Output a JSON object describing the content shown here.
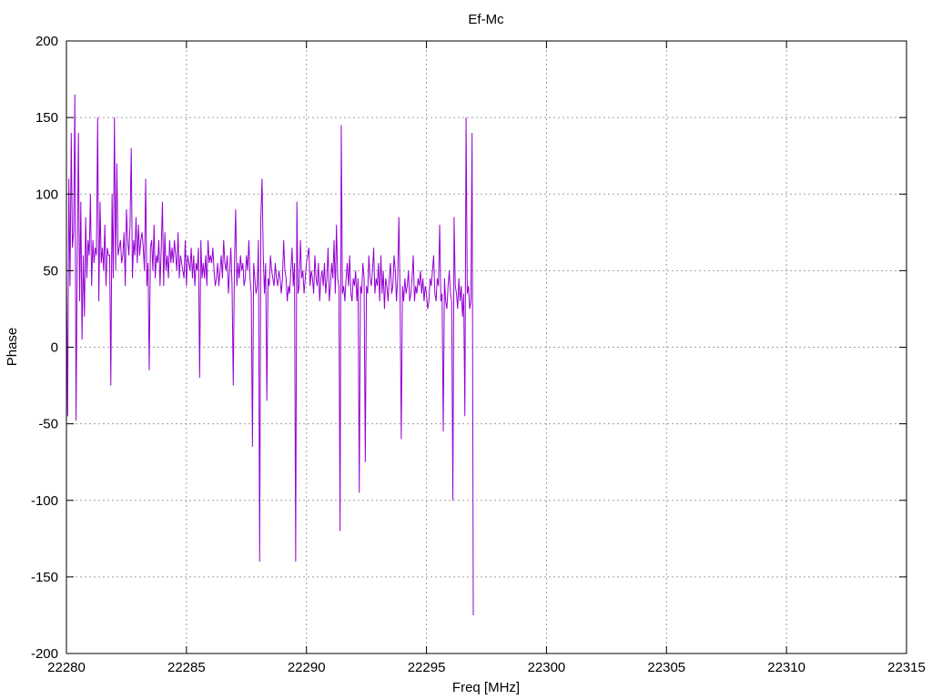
{
  "chart_data": {
    "type": "line",
    "title": "Ef-Mc",
    "xlabel": "Freq [MHz]",
    "ylabel": "Phase",
    "xlim": [
      22280,
      22315
    ],
    "ylim": [
      -200,
      200
    ],
    "xticks": [
      22280,
      22285,
      22290,
      22295,
      22300,
      22305,
      22310,
      22315
    ],
    "yticks": [
      -200,
      -150,
      -100,
      -50,
      0,
      50,
      100,
      150,
      200
    ],
    "grid": true,
    "line_color": "#9400d3",
    "series": [
      {
        "x_start": 22280.0,
        "x_step": 0.05,
        "values": [
          45,
          -45,
          110,
          40,
          140,
          65,
          75,
          165,
          -48,
          55,
          140,
          30,
          95,
          5,
          60,
          20,
          85,
          45,
          70,
          60,
          100,
          40,
          70,
          55,
          65,
          60,
          150,
          30,
          95,
          55,
          65,
          50,
          80,
          40,
          65,
          60,
          60,
          -25,
          100,
          45,
          150,
          50,
          120,
          60,
          65,
          70,
          55,
          60,
          75,
          40,
          90,
          70,
          60,
          80,
          130,
          45,
          70,
          60,
          85,
          55,
          80,
          60,
          70,
          75,
          65,
          50,
          110,
          40,
          55,
          -15,
          65,
          70,
          50,
          80,
          45,
          60,
          55,
          70,
          40,
          65,
          95,
          40,
          75,
          50,
          60,
          45,
          70,
          55,
          65,
          55,
          70,
          60,
          50,
          75,
          45,
          60,
          55,
          50,
          45,
          70,
          40,
          60,
          55,
          50,
          65,
          45,
          60,
          40,
          55,
          50,
          65,
          -20,
          70,
          45,
          55,
          45,
          60,
          40,
          70,
          55,
          60,
          55,
          65,
          50,
          40,
          45,
          55,
          40,
          50,
          60,
          45,
          70,
          55,
          50,
          60,
          35,
          50,
          65,
          40,
          -25,
          55,
          90,
          40,
          55,
          45,
          60,
          50,
          55,
          40,
          45,
          60,
          50,
          70,
          45,
          35,
          -65,
          55,
          45,
          35,
          40,
          70,
          -140,
          85,
          110,
          60,
          35,
          55,
          -35,
          45,
          40,
          60,
          50,
          45,
          40,
          55,
          45,
          40,
          50,
          45,
          35,
          45,
          70,
          50,
          45,
          30,
          40,
          35,
          50,
          65,
          40,
          55,
          -140,
          95,
          35,
          40,
          70,
          45,
          50,
          35,
          45,
          55,
          60,
          65,
          40,
          50,
          45,
          35,
          60,
          45,
          40,
          55,
          30,
          45,
          50,
          40,
          55,
          35,
          45,
          65,
          30,
          40,
          55,
          45,
          70,
          35,
          80,
          45,
          40,
          -120,
          145,
          35,
          40,
          30,
          45,
          55,
          40,
          60,
          35,
          30,
          45,
          40,
          50,
          30,
          45,
          -95,
          40,
          35,
          55,
          45,
          -75,
          40,
          35,
          60,
          45,
          40,
          50,
          65,
          35,
          45,
          40,
          55,
          30,
          60,
          35,
          50,
          25,
          45,
          40,
          30,
          45,
          55,
          35,
          40,
          60,
          50,
          30,
          45,
          85,
          35,
          -60,
          40,
          30,
          45,
          35,
          40,
          50,
          30,
          35,
          45,
          60,
          30,
          40,
          35,
          45,
          40,
          50,
          35,
          45,
          30,
          40,
          35,
          25,
          30,
          45,
          40,
          50,
          60,
          35,
          30,
          45,
          40,
          80,
          30,
          35,
          -55,
          45,
          30,
          25,
          40,
          50,
          35,
          30,
          -100,
          85,
          40,
          35,
          25,
          45,
          30,
          40,
          20,
          35,
          -45,
          150,
          35,
          40,
          25,
          30,
          140,
          -175
        ]
      }
    ]
  }
}
